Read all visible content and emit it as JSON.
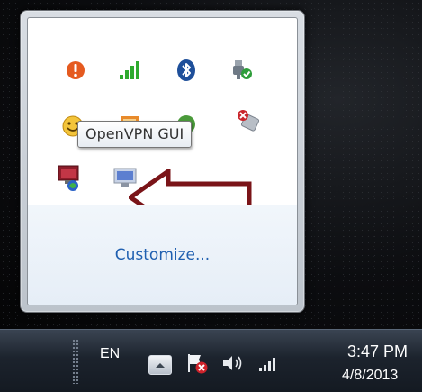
{
  "popup": {
    "tooltip": "OpenVPN GUI",
    "customize_link": "Customize...",
    "icons": [
      {
        "name": "warning-icon"
      },
      {
        "name": "signal-strength-icon"
      },
      {
        "name": "bluetooth-icon"
      },
      {
        "name": "usb-safely-remove-icon"
      },
      {
        "name": "smiley-icon"
      },
      {
        "name": "app-icon"
      },
      {
        "name": "green-app-icon"
      },
      {
        "name": "disconnected-drive-icon"
      },
      {
        "name": "openvpn-gui-icon"
      },
      {
        "name": "monitor-icon"
      }
    ],
    "annotation": {
      "name": "red-arrow",
      "color": "#7a1418"
    }
  },
  "taskbar": {
    "language": "EN",
    "clock_time": "3:47 PM",
    "clock_date": "4/8/2013",
    "icons": [
      {
        "name": "show-hidden-icons-button"
      },
      {
        "name": "action-center-flag-icon"
      },
      {
        "name": "volume-icon"
      },
      {
        "name": "network-signal-icon"
      }
    ]
  }
}
